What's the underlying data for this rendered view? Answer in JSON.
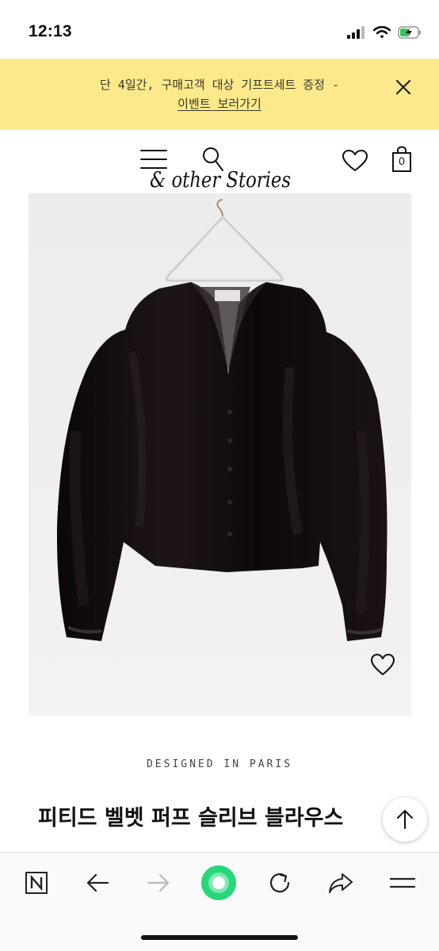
{
  "status_bar": {
    "time": "12:13",
    "icons": [
      "signal-icon",
      "wifi-icon",
      "battery-charging-icon"
    ]
  },
  "promo": {
    "text": "단 4일간, 구매고객 대상 기프트세트 증정 -",
    "link_label": "이벤트 보러가기",
    "background": "#fbe98c"
  },
  "header": {
    "logo_text": "& other Stories",
    "bag_count": "0",
    "icons": [
      "menu-icon",
      "search-icon",
      "heart-icon",
      "shopping-bag-icon"
    ]
  },
  "product": {
    "image_desc": "black-velvet-blouse-on-hanger",
    "designed_label": "DESIGNED IN PARIS",
    "title": "피티드 벨벳 퍼프 슬리브 블라우스"
  },
  "browser_toolbar": {
    "items": [
      "naver-n-icon",
      "back-arrow-icon",
      "forward-arrow-icon",
      "green-home-icon",
      "reload-icon",
      "share-icon",
      "menu-icon"
    ],
    "accent": "#2ad67a"
  }
}
